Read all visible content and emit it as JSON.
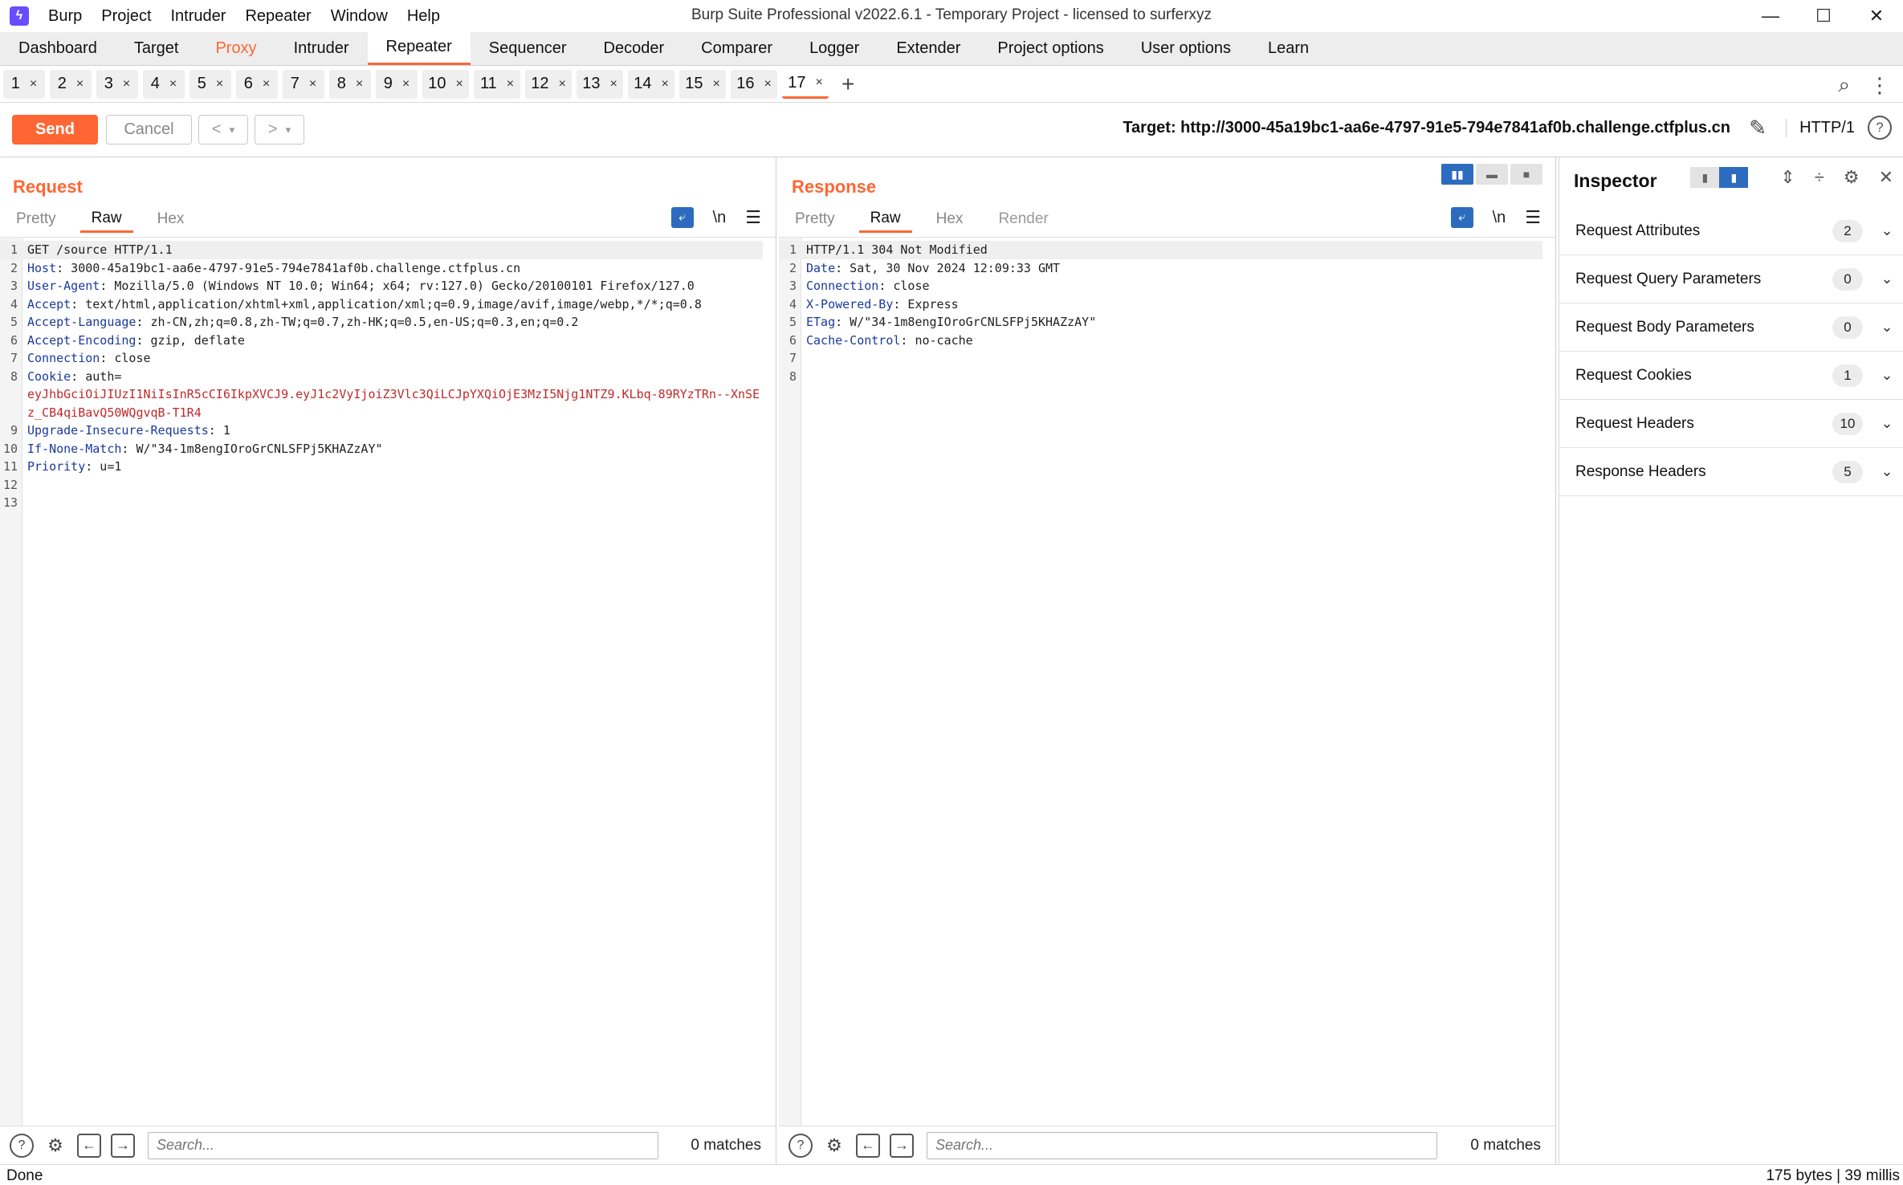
{
  "app": {
    "logo_glyph": "ϟ",
    "window_title": "Burp Suite Professional v2022.6.1 - Temporary Project - licensed to surferxyz",
    "menu": [
      "Burp",
      "Project",
      "Intruder",
      "Repeater",
      "Window",
      "Help"
    ],
    "window_controls": {
      "minimize": "—",
      "maximize": "☐",
      "close": "✕"
    }
  },
  "main_tabs": [
    "Dashboard",
    "Target",
    "Proxy",
    "Intruder",
    "Repeater",
    "Sequencer",
    "Decoder",
    "Comparer",
    "Logger",
    "Extender",
    "Project options",
    "User options",
    "Learn"
  ],
  "active_main_tab": "Repeater",
  "repeater_tabs": [
    "1",
    "2",
    "3",
    "4",
    "5",
    "6",
    "7",
    "8",
    "9",
    "10",
    "11",
    "12",
    "13",
    "14",
    "15",
    "16",
    "17"
  ],
  "active_repeater_tab": "17",
  "tab_close_glyph": "×",
  "add_tab_glyph": "+",
  "toolbar": {
    "send_label": "Send",
    "cancel_label": "Cancel",
    "back_glyph": "<",
    "forward_glyph": ">",
    "dropdown_glyph": "▾",
    "target": "Target: http://3000-45a19bc1-aa6e-4797-91e5-794e7841af0b.challenge.ctfplus.cn",
    "http_version": "HTTP/1",
    "help_glyph": "?"
  },
  "request": {
    "title": "Request",
    "view_tabs": [
      "Pretty",
      "Raw",
      "Hex"
    ],
    "active_view": "Raw",
    "lines": [
      {
        "n": "1",
        "text": "GET /source HTTP/1.1"
      },
      {
        "n": "2",
        "name": "Host",
        "value": " 3000-45a19bc1-aa6e-4797-91e5-794e7841af0b.challenge.ctfplus.cn"
      },
      {
        "n": "3",
        "name": "User-Agent",
        "value": " Mozilla/5.0 (Windows NT 10.0; Win64; x64; rv:127.0) Gecko/20100101 Firefox/127.0"
      },
      {
        "n": "4",
        "name": "Accept",
        "value": " text/html,application/xhtml+xml,application/xml;q=0.9,image/avif,image/webp,*/*;q=0.8"
      },
      {
        "n": "5",
        "name": "Accept-Language",
        "value": " zh-CN,zh;q=0.8,zh-TW;q=0.7,zh-HK;q=0.5,en-US;q=0.3,en;q=0.2"
      },
      {
        "n": "6",
        "name": "Accept-Encoding",
        "value": " gzip, deflate"
      },
      {
        "n": "7",
        "name": "Connection",
        "value": " close"
      },
      {
        "n": "8",
        "name": "Cookie",
        "value": " auth=",
        "cookie": "eyJhbGciOiJIUzI1NiIsInR5cCI6IkpXVCJ9.eyJ1c2VyIjoiZ3Vlc3QiLCJpYXQiOjE3MzI5Njg1NTZ9.KLbq-89RYzTRn--XnSEz_CB4qiBavQ50WQgvqB-T1R4"
      },
      {
        "n": "9",
        "name": "Upgrade-Insecure-Requests",
        "value": " 1"
      },
      {
        "n": "10",
        "name": "If-None-Match",
        "value": " W/\"34-1m8engIOroGrCNLSFPj5KHAZzAY\""
      },
      {
        "n": "11",
        "name": "Priority",
        "value": " u=1"
      },
      {
        "n": "12",
        "text": ""
      },
      {
        "n": "13",
        "text": ""
      }
    ],
    "search_placeholder": "Search...",
    "matches": "0 matches"
  },
  "response": {
    "title": "Response",
    "view_tabs": [
      "Pretty",
      "Raw",
      "Hex",
      "Render"
    ],
    "active_view": "Raw",
    "lines": [
      {
        "n": "1",
        "text": "HTTP/1.1 304 Not Modified"
      },
      {
        "n": "2",
        "name": "Date",
        "value": " Sat, 30 Nov 2024 12:09:33 GMT"
      },
      {
        "n": "3",
        "name": "Connection",
        "value": " close"
      },
      {
        "n": "4",
        "name": "X-Powered-By",
        "value": " Express"
      },
      {
        "n": "5",
        "name": "ETag",
        "value": " W/\"34-1m8engIOroGrCNLSFPj5KHAZzAY\""
      },
      {
        "n": "6",
        "name": "Cache-Control",
        "value": " no-cache"
      },
      {
        "n": "7",
        "text": ""
      },
      {
        "n": "8",
        "text": ""
      }
    ],
    "search_placeholder": "Search...",
    "matches": "0 matches"
  },
  "inspector": {
    "title": "Inspector",
    "sections": [
      {
        "name": "Request Attributes",
        "count": "2"
      },
      {
        "name": "Request Query Parameters",
        "count": "0"
      },
      {
        "name": "Request Body Parameters",
        "count": "0"
      },
      {
        "name": "Request Cookies",
        "count": "1"
      },
      {
        "name": "Request Headers",
        "count": "10"
      },
      {
        "name": "Response Headers",
        "count": "5"
      }
    ]
  },
  "editor_icons": {
    "wrap": "⤶",
    "newline": "\\n",
    "menu": "☰",
    "help": "?",
    "settings": "⚙",
    "prev": "←",
    "next": "→",
    "chevron": "⌄"
  },
  "status": {
    "left": "Done",
    "right": "175 bytes | 39 millis"
  },
  "colors": {
    "accent": "#ff6633",
    "toggle_active": "#2d6bbf",
    "header_name": "#1a3a9c",
    "cookie_value": "#c02a2a"
  }
}
